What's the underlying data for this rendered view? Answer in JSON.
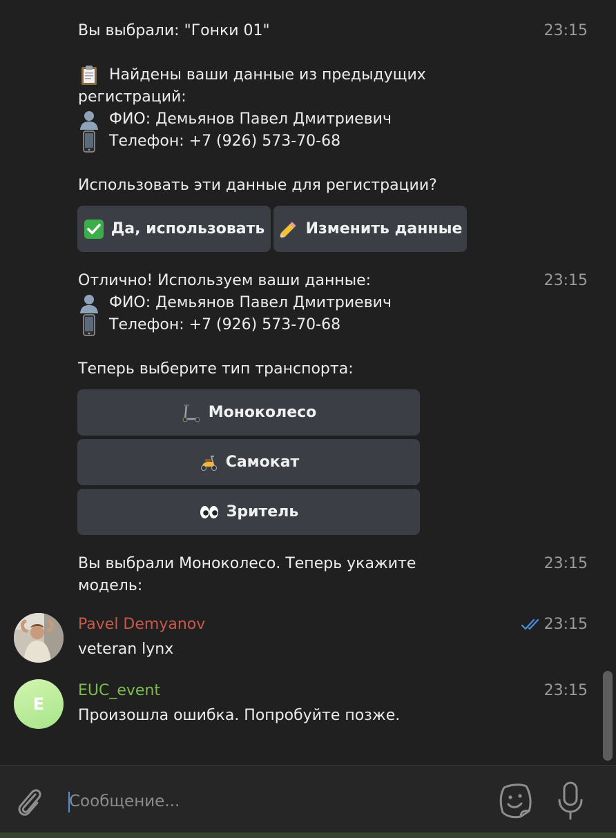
{
  "messages": {
    "m1": {
      "line1": "Вы выбрали: \"Гонки 01\"",
      "time": "23:15",
      "found_line1": "Найдены ваши данные из предыдущих",
      "found_line2": "регистраций:",
      "fio": "ФИО: Демьянов Павел Дмитриевич",
      "phone": "Телефон: +7 (926) 573-70-68",
      "question": "Использовать эти данные для регистрации?",
      "btn_yes": "Да, использовать",
      "btn_edit": "Изменить данные"
    },
    "m2": {
      "line1": "Отлично! Используем ваши данные:",
      "time": "23:15",
      "fio": "ФИО: Демьянов Павел Дмитриевич",
      "phone": "Телефон: +7 (926) 573-70-68",
      "question": "Теперь выберите тип транспорта:",
      "btn_mono": "Моноколесо",
      "btn_scooter": "Самокат",
      "btn_viewer": "Зритель"
    },
    "m3": {
      "line1": "Вы выбрали Моноколесо. Теперь укажите",
      "line2": "модель:",
      "time": "23:15"
    },
    "m4": {
      "sender": "Pavel Demyanov",
      "text": "veteran lynx",
      "time": "23:15"
    },
    "m5": {
      "sender": "EUC_event",
      "avatar_letter": "E",
      "text": "Произошла ошибка. Попробуйте позже.",
      "time": "23:15"
    }
  },
  "composer": {
    "placeholder": "Сообщение..."
  },
  "icons": {
    "clipboard": "clipboard-icon",
    "person": "person-icon",
    "phone": "mobile-phone-icon",
    "check": "check-mark-button-icon",
    "pencil": "pencil-icon",
    "kick_scooter": "kick-scooter-icon",
    "motor_scooter": "motor-scooter-icon",
    "eyes": "eyes-icon",
    "attach": "paperclip-icon",
    "sticker": "sticker-icon",
    "mic": "microphone-icon",
    "read_ticks": "double-check-icon"
  },
  "colors": {
    "sender_pavel": "#c8584a",
    "sender_bot": "#7cbb4e",
    "ticks": "#4a90e2",
    "button_bg": "#3b3e44"
  }
}
